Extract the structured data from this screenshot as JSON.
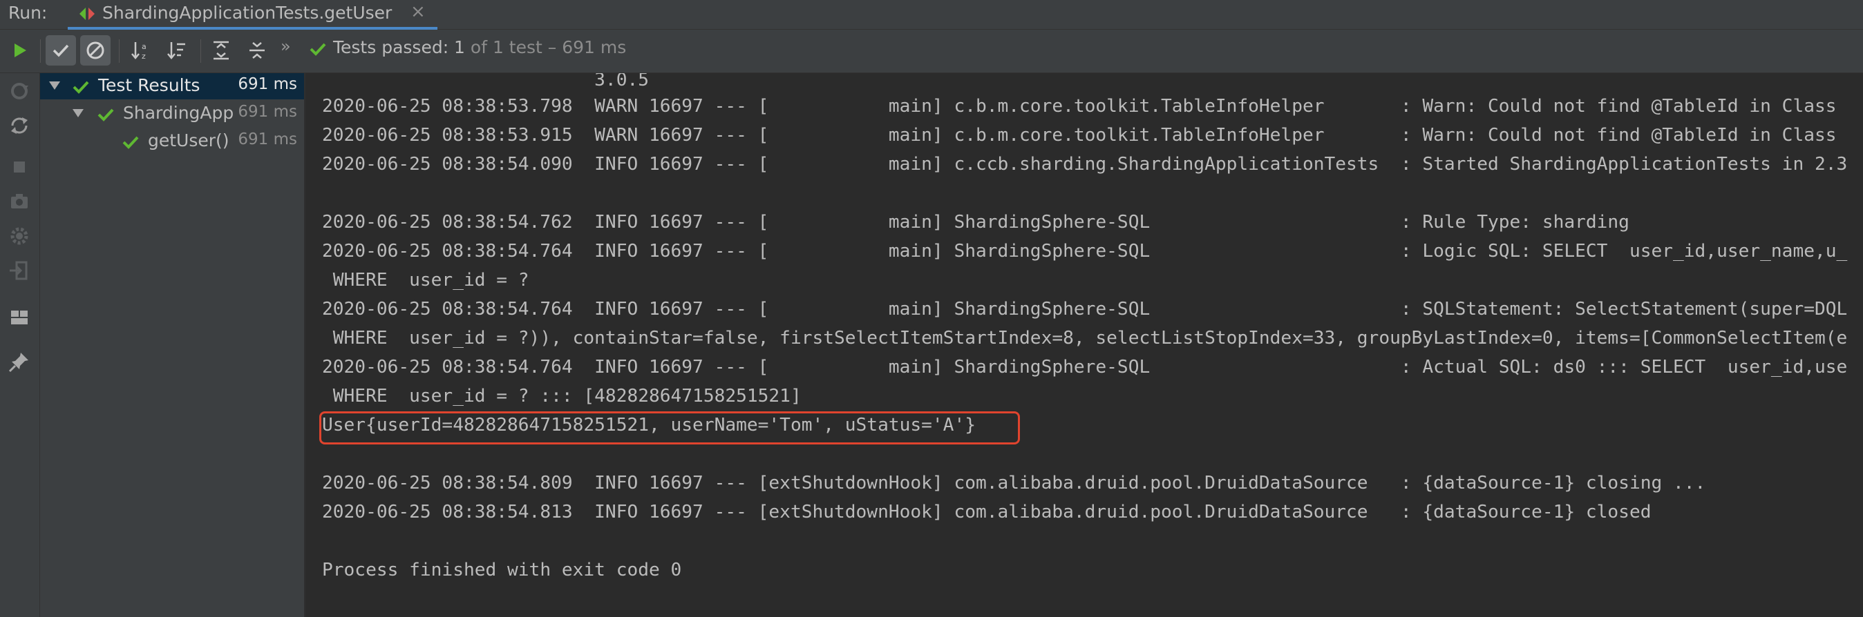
{
  "tabbar": {
    "run_label": "Run:",
    "tab_label": "ShardingApplicationTests.getUser",
    "close_glyph": "×"
  },
  "toolbar": {
    "buttons": [
      "rerun-icon",
      "show-passed-icon",
      "show-ignored-icon",
      "sort-alpha-icon",
      "sort-duration-icon",
      "expand-all-icon",
      "collapse-all-icon"
    ],
    "more_glyph": "»",
    "status_main": "Tests passed: 1",
    "status_detail": " of 1 test – 691 ms"
  },
  "tree": {
    "items": [
      {
        "label": "Test Results",
        "time": "691 ms"
      },
      {
        "label": "ShardingApp",
        "time": "691 ms"
      },
      {
        "label": "getUser()",
        "time": "691 ms"
      }
    ]
  },
  "console": {
    "lines": [
      "                         3.0.5",
      "2020-06-25 08:38:53.798  WARN 16697 --- [           main] c.b.m.core.toolkit.TableInfoHelper       : Warn: Could not find @TableId in Class",
      "2020-06-25 08:38:53.915  WARN 16697 --- [           main] c.b.m.core.toolkit.TableInfoHelper       : Warn: Could not find @TableId in Class",
      "2020-06-25 08:38:54.090  INFO 16697 --- [           main] c.ccb.sharding.ShardingApplicationTests  : Started ShardingApplicationTests in 2.3",
      "",
      "2020-06-25 08:38:54.762  INFO 16697 --- [           main] ShardingSphere-SQL                       : Rule Type: sharding",
      "2020-06-25 08:38:54.764  INFO 16697 --- [           main] ShardingSphere-SQL                       : Logic SQL: SELECT  user_id,user_name,u_",
      " WHERE  user_id = ?",
      "2020-06-25 08:38:54.764  INFO 16697 --- [           main] ShardingSphere-SQL                       : SQLStatement: SelectStatement(super=DQL",
      " WHERE  user_id = ?)), containStar=false, firstSelectItemStartIndex=8, selectListStopIndex=33, groupByLastIndex=0, items=[CommonSelectItem(e",
      "2020-06-25 08:38:54.764  INFO 16697 --- [           main] ShardingSphere-SQL                       : Actual SQL: ds0 ::: SELECT  user_id,use",
      " WHERE  user_id = ? ::: [482828647158251521]",
      "User{userId=482828647158251521, userName='Tom', uStatus='A'}",
      "",
      "2020-06-25 08:38:54.809  INFO 16697 --- [extShutdownHook] com.alibaba.druid.pool.DruidDataSource   : {dataSource-1} closing ...",
      "2020-06-25 08:38:54.813  INFO 16697 --- [extShutdownHook] com.alibaba.druid.pool.DruidDataSource   : {dataSource-1} closed",
      "",
      "Process finished with exit code 0"
    ]
  },
  "colors": {
    "background": "#2b2b2b",
    "panel": "#3c3f41",
    "pass_green": "#5fb832",
    "highlight_red": "#e0442e",
    "selection": "#0d293e"
  }
}
